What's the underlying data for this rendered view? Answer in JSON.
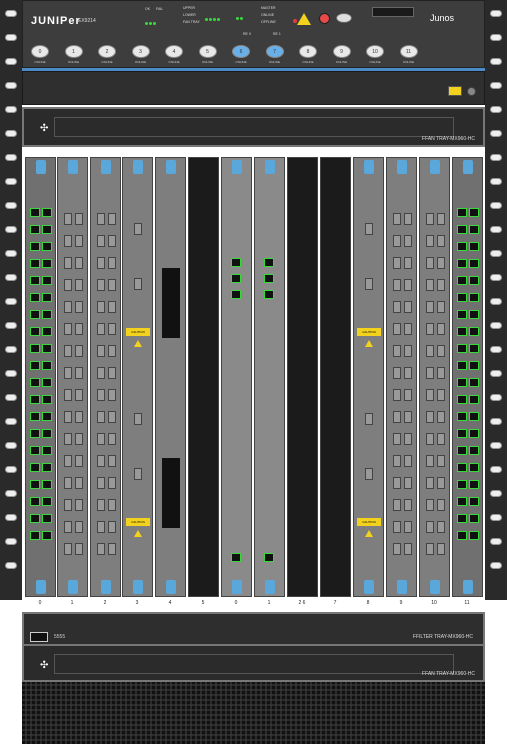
{
  "craft_panel": {
    "brand": "JUNIPer",
    "model": "EX9214",
    "os_logo": "Junos",
    "status_legend": {
      "ok_label": "OK",
      "fail_label": "FAIL",
      "upper_label": "UPPER",
      "lower_label": "LOWER",
      "fan_tray_label": "FAN TRAY",
      "master_label": "MASTER",
      "online_label": "ONLINE",
      "offline_label": "OFFLINE",
      "re0": "RE 0",
      "re1": "RE 1",
      "pem_label": "PEM"
    },
    "fpc_buttons": [
      "0",
      "1",
      "2",
      "3",
      "4",
      "5",
      "6",
      "7",
      "8",
      "9",
      "10",
      "11"
    ],
    "fpc_online_label": "ONLINE",
    "active_fpc": [
      "6",
      "7"
    ]
  },
  "fan_tray_top": {
    "label": "FFAN TRAY-MX960-HC"
  },
  "slots": [
    {
      "num": "0",
      "type": "rj"
    },
    {
      "num": "1",
      "type": "sfp"
    },
    {
      "num": "2",
      "type": "sfp"
    },
    {
      "num": "3",
      "type": "mic"
    },
    {
      "num": "4",
      "type": "blank"
    },
    {
      "num": "5",
      "type": "empty"
    },
    {
      "num": "0",
      "type": "re"
    },
    {
      "num": "1",
      "type": "re"
    },
    {
      "num": "2 6",
      "type": "empty"
    },
    {
      "num": "7",
      "type": "empty"
    },
    {
      "num": "8",
      "type": "mic"
    },
    {
      "num": "9",
      "type": "sfp"
    },
    {
      "num": "10",
      "type": "sfp"
    },
    {
      "num": "11",
      "type": "rj"
    }
  ],
  "caution_text": "CAUTION",
  "filter_tray": {
    "label": "FFILTER TRAY-MX960-HC"
  },
  "fan_tray_bottom": {
    "label": "FFAN TRAY-MX960-HC"
  },
  "colors": {
    "led_green": "#3ad83a",
    "latch_blue": "#5aa7dc",
    "warning_yellow": "#f3d21e",
    "chassis_dark": "#2b2b2b"
  }
}
